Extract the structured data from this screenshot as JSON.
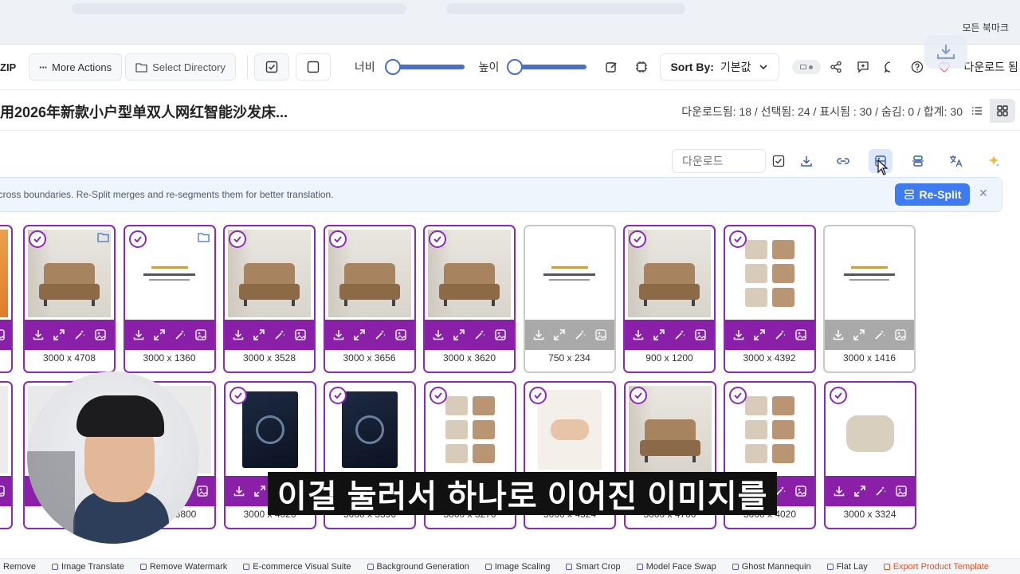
{
  "browser": {
    "bookmark_label": "모든 북마크"
  },
  "toolbar": {
    "zip_label": "ZIP",
    "more_actions": "More Actions",
    "select_directory": "Select Directory",
    "width_label": "너비",
    "height_label": "높이",
    "sort_prefix": "Sort By:",
    "sort_value": "기본값",
    "download_label": "다운로드 됨",
    "width_value": 0,
    "height_value": 0
  },
  "header": {
    "title": "用2026年新款小户型单双人网红智能沙发床...",
    "stats": "다운로드됨: 18 / 선택됨: 24 / 표시됨 : 30 / 숨김: 0 / 합계: 30"
  },
  "actions": {
    "download_placeholder": "다운로드"
  },
  "banner": {
    "text": "ncross boundaries. Re-Split merges and re-segments them for better translation.",
    "resplit_label": "Re-Split"
  },
  "row1": [
    {
      "dims": "3000 x 4708",
      "checked": true,
      "style": "sofa"
    },
    {
      "dims": "3000 x 1360",
      "checked": true,
      "style": "text"
    },
    {
      "dims": "3000 x 3528",
      "checked": true,
      "style": "sofa"
    },
    {
      "dims": "3000 x 3656",
      "checked": true,
      "style": "sofa"
    },
    {
      "dims": "3000 x 3620",
      "checked": true,
      "style": "sofa"
    },
    {
      "dims": "750 x 234",
      "checked": false,
      "style": "text"
    },
    {
      "dims": "900 x 1200",
      "checked": true,
      "style": "sofa"
    },
    {
      "dims": "3000 x 4392",
      "checked": true,
      "style": "grid"
    },
    {
      "dims": "3000 x 1416",
      "checked": false,
      "style": "text"
    }
  ],
  "row2": [
    {
      "dims": "3000 x 4020",
      "checked": true,
      "style": "dark"
    },
    {
      "dims": "3000 x 3396",
      "checked": true,
      "style": "dark"
    },
    {
      "dims": "3000 x 3270",
      "checked": true,
      "style": "grid"
    },
    {
      "dims": "3000 x 4324",
      "checked": true,
      "style": "hand"
    },
    {
      "dims": "3000 x 4700",
      "checked": true,
      "style": "sofa"
    },
    {
      "dims": "3000 x 4020",
      "checked": true,
      "style": "grid"
    },
    {
      "dims": "3000 x 3324",
      "checked": true,
      "style": "beige"
    }
  ],
  "partial_dims": {
    "row2_first": "3",
    "row2_second": "3800"
  },
  "bottom_tools": [
    "Remove",
    "Image Translate",
    "Remove Watermark",
    "E-commerce Visual Suite",
    "Background Generation",
    "Image Scaling",
    "Smart Crop",
    "Model Face Swap",
    "Ghost Mannequin",
    "Flat Lay",
    "Export Product Template"
  ],
  "subtitle": "이걸 눌러서 하나로 이어진 이미지를",
  "colors": {
    "accent": "#8a1fa8",
    "blue": "#3f7bf0"
  }
}
